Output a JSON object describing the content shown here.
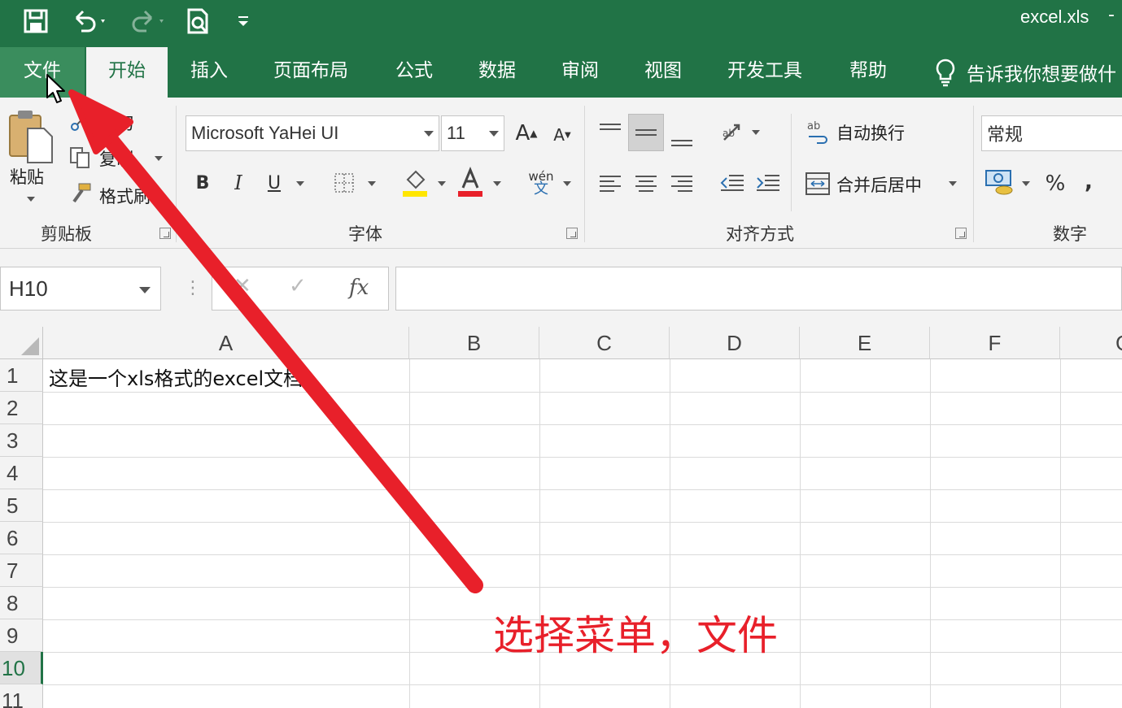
{
  "window": {
    "title": "excel.xls",
    "minimize": "-"
  },
  "quick_access": {
    "icons": [
      "save-icon",
      "undo-icon",
      "redo-icon",
      "print-preview-icon",
      "customize-icon"
    ]
  },
  "ribbon_tabs": [
    "文件",
    "开始",
    "插入",
    "页面布局",
    "公式",
    "数据",
    "审阅",
    "视图",
    "开发工具",
    "帮助"
  ],
  "active_tab": "开始",
  "tell_me": "告诉我你想要做什",
  "clipboard": {
    "paste": "粘贴",
    "cut": "剪切",
    "copy": "复制",
    "format_painter": "格式刷",
    "group_label": "剪贴板"
  },
  "font": {
    "font_name": "Microsoft YaHei UI",
    "font_size": "11",
    "group_label": "字体",
    "bold": "B",
    "italic": "I",
    "underline": "U",
    "phonetic": "wén"
  },
  "alignment": {
    "wrap_text": "自动换行",
    "merge_center": "合并后居中",
    "group_label": "对齐方式"
  },
  "number": {
    "format": "常规",
    "percent": "%",
    "comma": ",",
    "group_label": "数字"
  },
  "formula_bar": {
    "name_box": "H10",
    "fx": "fx",
    "formula": ""
  },
  "sheet": {
    "columns": [
      "A",
      "B",
      "C",
      "D",
      "E",
      "F",
      "G"
    ],
    "rows": [
      "1",
      "2",
      "3",
      "4",
      "5",
      "6",
      "7",
      "8",
      "9",
      "10",
      "11"
    ],
    "selected_row": "10",
    "cell_a1": "这是一个xls格式的excel文档"
  },
  "annotation": {
    "caption": "选择菜单，文件",
    "color": "#e8202a"
  },
  "colors": {
    "accent": "#217346",
    "ribbon_bg": "#f3f3f3"
  }
}
